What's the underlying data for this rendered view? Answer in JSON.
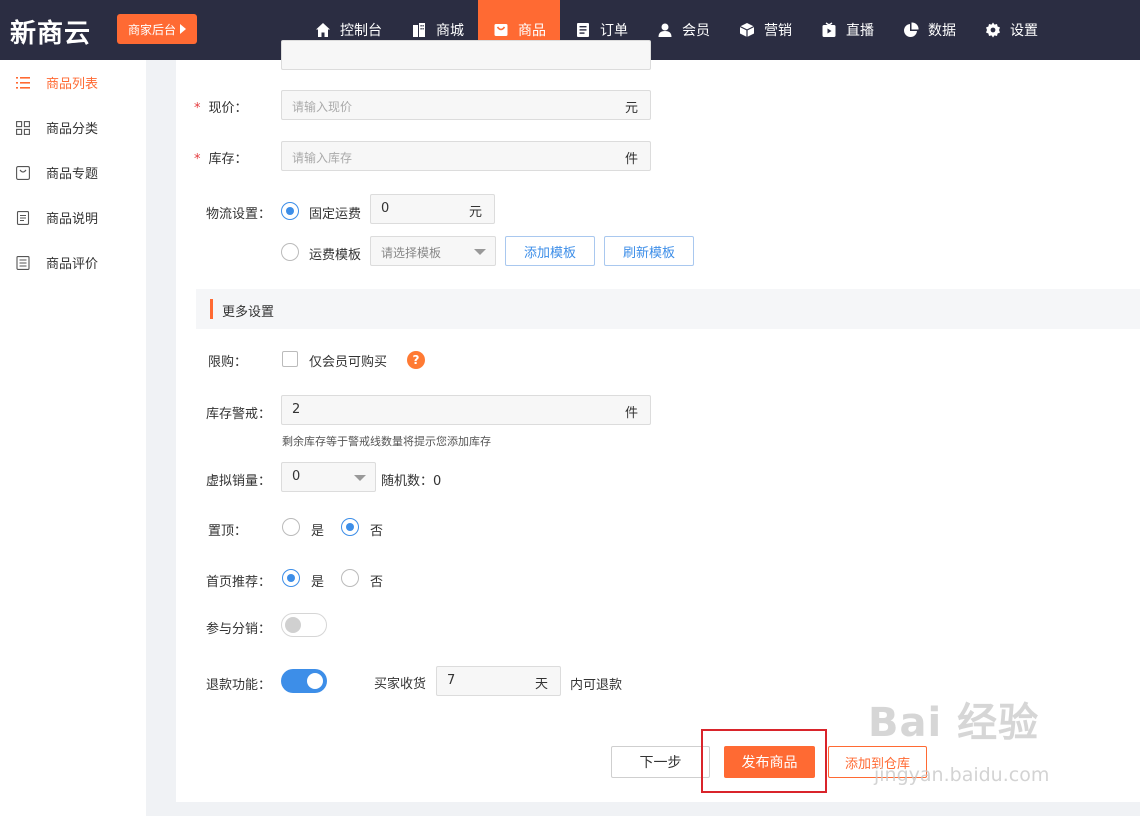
{
  "header": {
    "logo": "新商云",
    "merchant_button": "商家后台",
    "nav": [
      {
        "label": "控制台",
        "icon": "home-icon"
      },
      {
        "label": "商城",
        "icon": "building-icon"
      },
      {
        "label": "商品",
        "icon": "bag-icon",
        "active": true
      },
      {
        "label": "订单",
        "icon": "order-icon"
      },
      {
        "label": "会员",
        "icon": "user-icon"
      },
      {
        "label": "营销",
        "icon": "cube-icon"
      },
      {
        "label": "直播",
        "icon": "live-icon"
      },
      {
        "label": "数据",
        "icon": "pie-chart-icon"
      },
      {
        "label": "设置",
        "icon": "gear-icon"
      }
    ]
  },
  "sidebar": {
    "items": [
      {
        "label": "商品列表",
        "icon": "list-icon",
        "active": true
      },
      {
        "label": "商品分类",
        "icon": "grid-icon"
      },
      {
        "label": "商品专题",
        "icon": "topic-icon"
      },
      {
        "label": "商品说明",
        "icon": "doc-icon"
      },
      {
        "label": "商品评价",
        "icon": "review-icon"
      }
    ]
  },
  "form": {
    "price": {
      "label": "现价：",
      "placeholder": "请输入现价",
      "unit": "元"
    },
    "stock": {
      "label": "库存：",
      "placeholder": "请输入库存",
      "unit": "件"
    },
    "logistics": {
      "label": "物流设置：",
      "fixed_label": "固定运费",
      "fixed_value": "0",
      "fixed_unit": "元",
      "template_label": "运费模板",
      "template_placeholder": "请选择模板",
      "add_template": "添加模板",
      "refresh_template": "刷新模板"
    },
    "more_settings": "更多设置",
    "limit": {
      "label": "限购：",
      "checkbox_label": "仅会员可购买",
      "help": "?"
    },
    "stock_alert": {
      "label": "库存警戒：",
      "value": "2",
      "unit": "件",
      "hint": "剩余库存等于警戒线数量将提示您添加库存"
    },
    "virtual_sales": {
      "label": "虚拟销量：",
      "value": "0",
      "random_label": "随机数：0"
    },
    "pin_top": {
      "label": "置顶：",
      "yes": "是",
      "no": "否"
    },
    "home_recommend": {
      "label": "首页推荐：",
      "yes": "是",
      "no": "否"
    },
    "distribution": {
      "label": "参与分销："
    },
    "refund": {
      "label": "退款功能：",
      "receive_label": "买家收货",
      "days_value": "7",
      "days_unit": "天",
      "suffix": "内可退款"
    }
  },
  "actions": {
    "next": "下一步",
    "publish": "发布商品",
    "add_to_warehouse": "添加到仓库"
  },
  "watermark": {
    "title": "Bai 经验",
    "url": "jingyan.baidu.com"
  }
}
